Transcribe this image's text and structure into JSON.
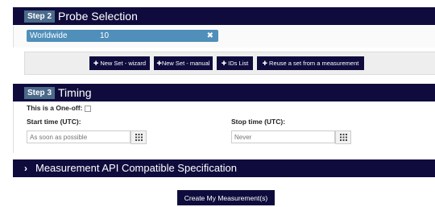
{
  "step2": {
    "badge": "Step 2",
    "title": "Probe Selection"
  },
  "probe_set": {
    "area": "Worldwide",
    "count": "10",
    "remove_glyph": "✖"
  },
  "toolbar": {
    "new_set_wizard": "✚ New Set - wizard",
    "new_set_manual": "✚New Set - manual",
    "ids_list": "✚ IDs List",
    "reuse_set": "✚ Reuse a set from a measurement"
  },
  "step3": {
    "badge": "Step 3",
    "title": "Timing"
  },
  "timing": {
    "one_off_label": "This is a One-off:",
    "one_off_checked": false,
    "start_label": "Start time (UTC):",
    "start_placeholder": "As soon as possible",
    "stop_label": "Stop time (UTC):",
    "stop_placeholder": "Never",
    "calendar_icon": "calendar-grid-icon"
  },
  "api_spec": {
    "chevron": "›",
    "title": "Measurement API Compatible Specification"
  },
  "submit": {
    "label": "Create My Measurement(s)"
  },
  "colors": {
    "header_bar": "#0f0c3d",
    "step_badge": "#4a6a8a",
    "probe_row": "#4f8fba",
    "toolbar_bg": "#eeeeee"
  }
}
